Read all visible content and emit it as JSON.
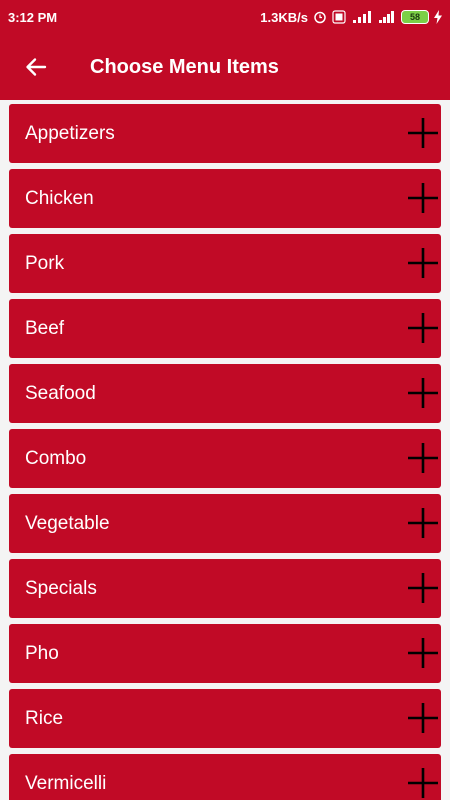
{
  "status_bar": {
    "time": "3:12 PM",
    "net_speed": "1.3KB/s",
    "battery": "58",
    "icons": [
      "alarm-icon",
      "volte-icon",
      "signal-4g-icon",
      "signal-icon",
      "battery-icon",
      "charging-icon"
    ]
  },
  "app_bar": {
    "back_icon": "arrow-left-icon",
    "title": "Choose Menu Items"
  },
  "menu": {
    "add_icon": "plus-icon",
    "items": [
      {
        "label": "Appetizers"
      },
      {
        "label": "Chicken"
      },
      {
        "label": "Pork"
      },
      {
        "label": "Beef"
      },
      {
        "label": "Seafood"
      },
      {
        "label": "Combo"
      },
      {
        "label": "Vegetable"
      },
      {
        "label": "Specials"
      },
      {
        "label": "Pho"
      },
      {
        "label": "Rice"
      },
      {
        "label": "Vermicelli"
      }
    ]
  },
  "colors": {
    "primary": "#c10a26",
    "text": "#ffffff",
    "icon": "#000000",
    "list_background": "#f4f4f4"
  }
}
